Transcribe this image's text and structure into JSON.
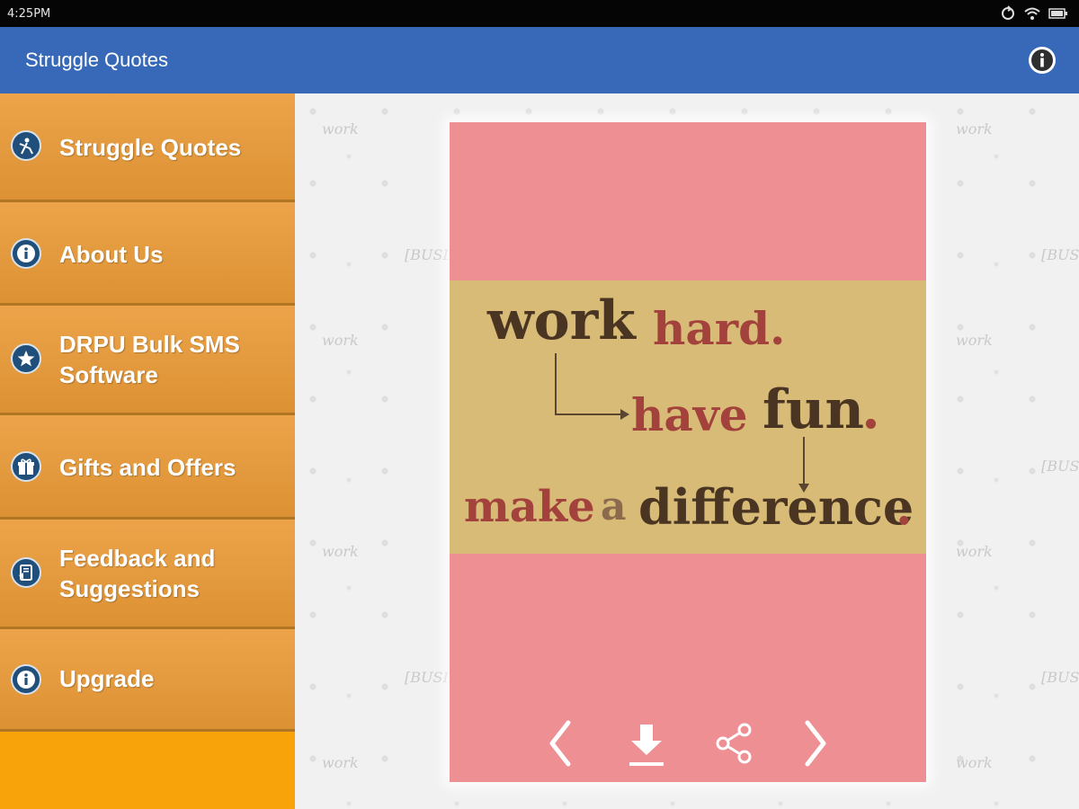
{
  "status_bar": {
    "time": "4:25PM"
  },
  "app_bar": {
    "title": "Struggle Quotes",
    "info_icon": "info-icon"
  },
  "drawer": {
    "items": [
      {
        "label": "Struggle Quotes",
        "icon": "climber-icon"
      },
      {
        "label": "About Us",
        "icon": "info-icon"
      },
      {
        "label": "DRPU Bulk SMS Software",
        "line1": "DRPU Bulk SMS",
        "line2": "Software",
        "icon": "star-icon"
      },
      {
        "label": "Gifts and Offers",
        "icon": "gift-icon"
      },
      {
        "label": "Feedback and Suggestions",
        "line1": "Feedback and",
        "line2": "Suggestions",
        "icon": "feedback-icon"
      },
      {
        "label": "Upgrade",
        "icon": "info-icon"
      }
    ]
  },
  "background": {
    "word_work": "work",
    "word_business": "[BUSINESS]"
  },
  "quote": {
    "work": "work",
    "hard": "hard.",
    "have": "have",
    "fun": "fun",
    "fun_dot": ".",
    "make": "make",
    "a": "a",
    "difference": "difference",
    "difference_dot": "."
  },
  "controls": {
    "prev_icon": "chevron-left-icon",
    "download_icon": "download-icon",
    "share_icon": "share-icon",
    "next_icon": "chevron-right-icon"
  },
  "colors": {
    "app_bar": "#3769b8",
    "drawer": "#f8a30a",
    "card": "#ee8f93",
    "band": "#d7bb77",
    "quote_dark": "#4a3523",
    "quote_red": "#a3423c"
  }
}
